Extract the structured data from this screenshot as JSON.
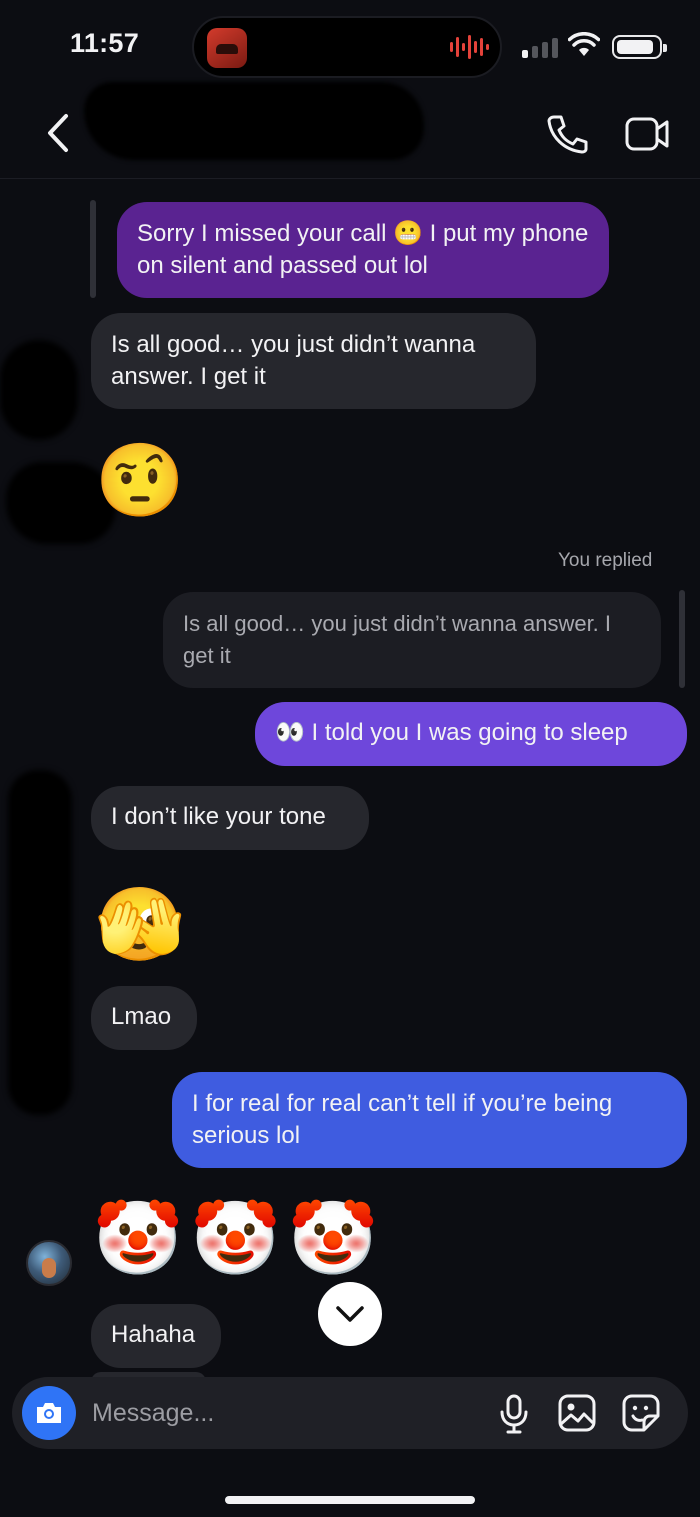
{
  "status_bar": {
    "time": "11:57"
  },
  "header": {
    "contact_name": "",
    "icons": [
      "back-chevron-icon",
      "phone-icon",
      "video-camera-icon"
    ]
  },
  "messages": [
    {
      "from": "me",
      "style": "purple",
      "text": "Sorry I missed your call 😬 I put my phone on silent and passed out lol"
    },
    {
      "from": "them",
      "style": "gray",
      "text": "Is all good… you just didn’t wanna answer. I get it"
    },
    {
      "from": "them",
      "style": "emoji",
      "text": "🤨"
    },
    {
      "from": "me",
      "style": "reply-label",
      "text": "You replied"
    },
    {
      "from": "me",
      "style": "quoted",
      "text": "Is all good… you just didn’t wanna answer. I get it"
    },
    {
      "from": "me",
      "style": "violet",
      "text": "👀 I told you I was going to sleep"
    },
    {
      "from": "them",
      "style": "gray",
      "text": "I don’t like your tone"
    },
    {
      "from": "them",
      "style": "emoji",
      "text": "🫣"
    },
    {
      "from": "them",
      "style": "gray",
      "text": "Lmao"
    },
    {
      "from": "me",
      "style": "blue",
      "text": "I for real for real can’t tell if you’re being serious lol"
    },
    {
      "from": "them",
      "style": "emoji",
      "text": "🤡🤡🤡"
    },
    {
      "from": "them",
      "style": "gray",
      "text": "Hahaha"
    }
  ],
  "composer": {
    "placeholder": "Message...",
    "icons": [
      "camera-icon",
      "microphone-icon",
      "photo-icon",
      "sticker-icon"
    ]
  },
  "colors": {
    "background": "#0c0d12",
    "incoming_bubble": "#26272d",
    "outgoing_purple": "#5a2391",
    "outgoing_violet": "#6e47db",
    "outgoing_blue": "#3f5ce0",
    "camera_button": "#2f74f6"
  }
}
